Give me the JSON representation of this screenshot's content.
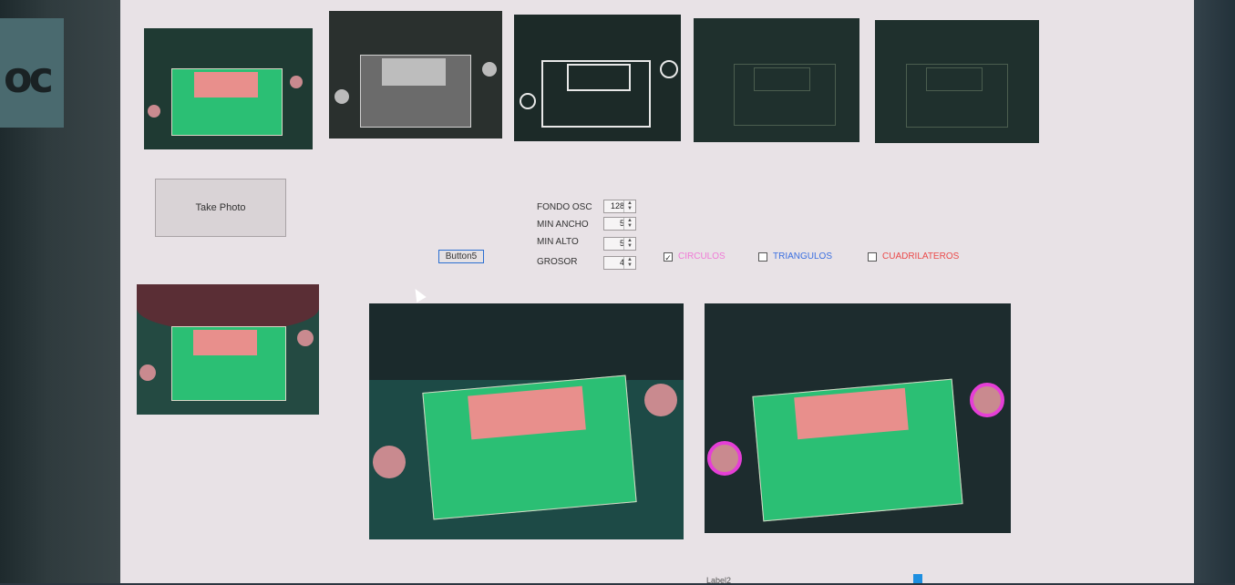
{
  "buttons": {
    "take_photo": "Take Photo",
    "button5": "Button5"
  },
  "params": [
    {
      "label": "FONDO OSC",
      "value": "128"
    },
    {
      "label": "MIN ANCHO",
      "value": "5"
    },
    {
      "label": "MIN ALTO",
      "value": "5"
    },
    {
      "label": "GROSOR",
      "value": "4"
    }
  ],
  "checkboxes": [
    {
      "label": "CIRCULOS",
      "checked": true,
      "color": "#f07ad6"
    },
    {
      "label": "TRIANGULOS",
      "checked": false,
      "color": "#3a6fe0"
    },
    {
      "label": "CUADRILATEROS",
      "checked": false,
      "color": "#ea4a4a"
    }
  ],
  "bottom": {
    "label": "Label2"
  },
  "colors": {
    "background": "#e8e2e6",
    "highlight": "#e53fd6",
    "pcb": "#2bbf74",
    "connector": "#e88f8c"
  }
}
